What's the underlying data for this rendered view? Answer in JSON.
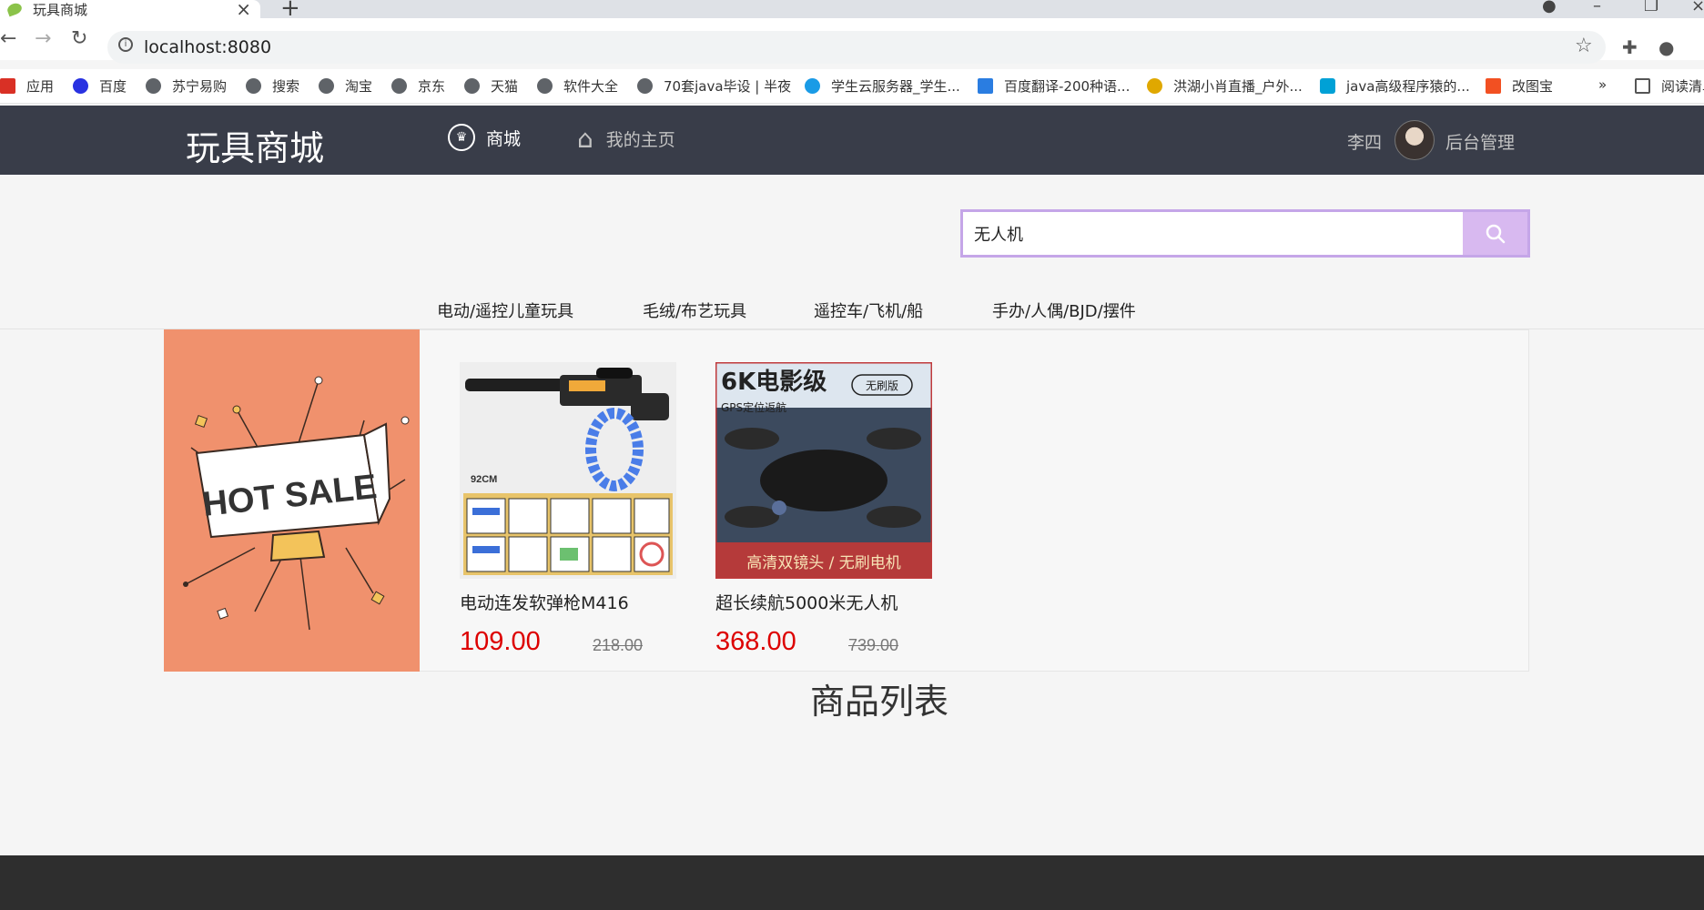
{
  "browser": {
    "tab_title": "玩具商城",
    "url": "localhost:8080",
    "bookmarks": [
      {
        "label": "应用"
      },
      {
        "label": "百度"
      },
      {
        "label": "苏宁易购"
      },
      {
        "label": "搜索"
      },
      {
        "label": "淘宝"
      },
      {
        "label": "京东"
      },
      {
        "label": "天猫"
      },
      {
        "label": "软件大全"
      },
      {
        "label": "70套java毕设 | 半夜"
      },
      {
        "label": "学生云服务器_学生..."
      },
      {
        "label": "百度翻译-200种语..."
      },
      {
        "label": "洪湖小肖直播_户外..."
      },
      {
        "label": "java高级程序猿的..."
      },
      {
        "label": "改图宝"
      },
      {
        "label": "阅读清单"
      }
    ],
    "more_glyph": "»"
  },
  "site": {
    "logo": "玩具商城",
    "nav": [
      {
        "label": "商城",
        "icon": "crown-icon"
      },
      {
        "label": "我的主页",
        "icon": "home-icon"
      }
    ],
    "user_name": "李四",
    "admin_link": "后台管理"
  },
  "search": {
    "value": "无人机"
  },
  "categories": [
    "电动/遥控儿童玩具",
    "毛绒/布艺玩具",
    "遥控车/飞机/船",
    "手办/人偶/BJD/摆件"
  ],
  "banner": {
    "text": "HOT SALE"
  },
  "products": [
    {
      "name": "电动连发软弹枪M416",
      "price": "109.00",
      "original_price": "218.00",
      "img_caption": "92CM"
    },
    {
      "name": "超长续航5000米无人机",
      "price": "368.00",
      "original_price": "739.00",
      "img_title": "6K电影级",
      "img_badge": "无刷版",
      "img_sub": "GPS定位返航",
      "img_bottom": "高清双镜头 / 无刷电机"
    }
  ],
  "section_title": "商品列表",
  "colors": {
    "header_bg": "#393d49",
    "search_border": "#c5a6e8",
    "price": "#dd0000",
    "banner_bg": "#f0916d"
  }
}
